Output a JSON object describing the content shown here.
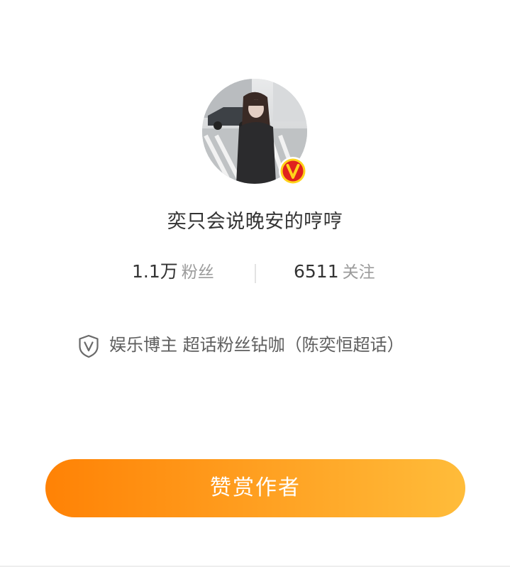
{
  "profile": {
    "nickname": "奕只会说晚安的哼哼",
    "verified_badge_icon": "verified-v-icon",
    "badge_colors": {
      "fill": "#e0211e",
      "ring": "#ffd31a",
      "letter": "#ffd31a"
    }
  },
  "stats": {
    "fans_count": "1.1万",
    "fans_label": "粉丝",
    "follow_count": "6511",
    "follow_label": "关注"
  },
  "verification": {
    "icon": "shield-v-icon",
    "text": "娱乐博主 超话粉丝钻咖（陈奕恒超话）"
  },
  "reward": {
    "label": "赞赏作者",
    "gradient": [
      "#ff8205",
      "#ffbc3a"
    ]
  }
}
